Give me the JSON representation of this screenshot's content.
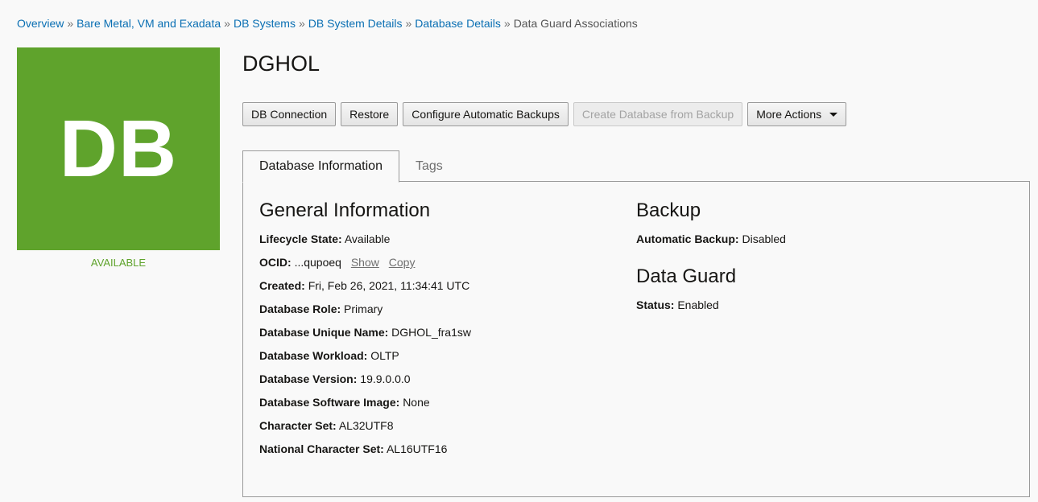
{
  "breadcrumb": {
    "items": [
      {
        "label": "Overview"
      },
      {
        "label": "Bare Metal, VM and Exadata"
      },
      {
        "label": "DB Systems"
      },
      {
        "label": "DB System Details"
      },
      {
        "label": "Database Details"
      }
    ],
    "separator": "»",
    "current": "Data Guard Associations"
  },
  "tile": {
    "text": "DB",
    "color": "#5fa32c",
    "status": "AVAILABLE"
  },
  "title": "DGHOL",
  "actions": {
    "db_connection": "DB Connection",
    "restore": "Restore",
    "configure_backups": "Configure Automatic Backups",
    "create_from_backup": "Create Database from Backup",
    "more_actions": "More Actions"
  },
  "tabs": {
    "database_information": "Database Information",
    "tags": "Tags"
  },
  "general": {
    "title": "General Information",
    "lifecycle_label": "Lifecycle State:",
    "lifecycle_value": "Available",
    "ocid_label": "OCID:",
    "ocid_value": "...qupoeq",
    "ocid_show": "Show",
    "ocid_copy": "Copy",
    "created_label": "Created:",
    "created_value": "Fri, Feb 26, 2021, 11:34:41 UTC",
    "role_label": "Database Role:",
    "role_value": "Primary",
    "unique_name_label": "Database Unique Name:",
    "unique_name_value": "DGHOL_fra1sw",
    "workload_label": "Database Workload:",
    "workload_value": "OLTP",
    "version_label": "Database Version:",
    "version_value": "19.9.0.0.0",
    "software_image_label": "Database Software Image:",
    "software_image_value": "None",
    "charset_label": "Character Set:",
    "charset_value": "AL32UTF8",
    "ncharset_label": "National Character Set:",
    "ncharset_value": "AL16UTF16"
  },
  "backup": {
    "title": "Backup",
    "auto_label": "Automatic Backup:",
    "auto_value": "Disabled"
  },
  "dataguard": {
    "title": "Data Guard",
    "status_label": "Status:",
    "status_value": "Enabled"
  }
}
